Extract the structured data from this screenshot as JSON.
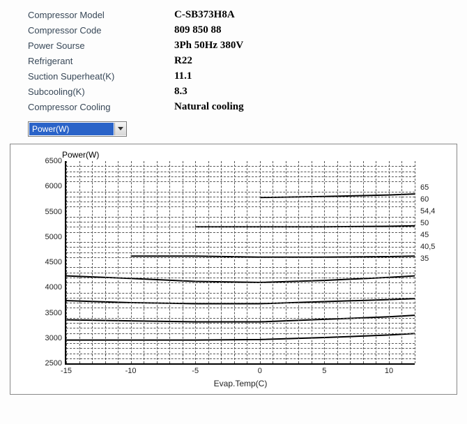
{
  "specs": [
    {
      "label": "Compressor  Model",
      "value": "C-SB373H8A"
    },
    {
      "label": "Compressor Code",
      "value": "809 850 88"
    },
    {
      "label": "Power Sourse",
      "value": "3Ph  50Hz  380V"
    },
    {
      "label": "Refrigerant",
      "value": "R22"
    },
    {
      "label": "Suction Superheat(K)",
      "value": "11.1"
    },
    {
      "label": "Subcooling(K)",
      "value": "8.3"
    },
    {
      "label": "Compressor Cooling",
      "value": "Natural cooling"
    }
  ],
  "dropdown": {
    "selected": "Power(W)"
  },
  "legend_labels": [
    "65",
    "60",
    "54,4",
    "50",
    "45",
    "40,5",
    "35"
  ],
  "chart_data": {
    "type": "line",
    "title": "Power(W)",
    "xlabel": "Evap.Temp(C)",
    "ylabel": "Power(W)",
    "xlim": [
      -15,
      12
    ],
    "ylim": [
      2500,
      6500
    ],
    "x_ticks": [
      -15,
      -10,
      -5,
      0,
      5,
      10
    ],
    "y_ticks": [
      2500,
      3000,
      3500,
      4000,
      4500,
      5000,
      5500,
      6000,
      6500
    ],
    "x": [
      -15,
      -10,
      -5,
      0,
      5,
      10,
      12
    ],
    "series": [
      {
        "name": "65",
        "start_x": 0,
        "values": [
          5780,
          5800,
          5830,
          5850
        ]
      },
      {
        "name": "60",
        "start_x": -5,
        "values": [
          5200,
          5200,
          5200,
          5210,
          5220
        ]
      },
      {
        "name": "54,4",
        "start_x": -10,
        "values": [
          4620,
          4620,
          4600,
          4600,
          4610,
          4620
        ]
      },
      {
        "name": "50",
        "start_x": -15,
        "values": [
          4230,
          4180,
          4120,
          4100,
          4140,
          4200,
          4230
        ]
      },
      {
        "name": "45",
        "start_x": -15,
        "values": [
          3740,
          3700,
          3680,
          3680,
          3720,
          3760,
          3780
        ]
      },
      {
        "name": "40,5",
        "start_x": -15,
        "values": [
          3360,
          3340,
          3320,
          3320,
          3370,
          3420,
          3450
        ]
      },
      {
        "name": "35",
        "start_x": -15,
        "values": [
          2960,
          2960,
          2960,
          2970,
          3010,
          3060,
          3090
        ]
      }
    ]
  }
}
